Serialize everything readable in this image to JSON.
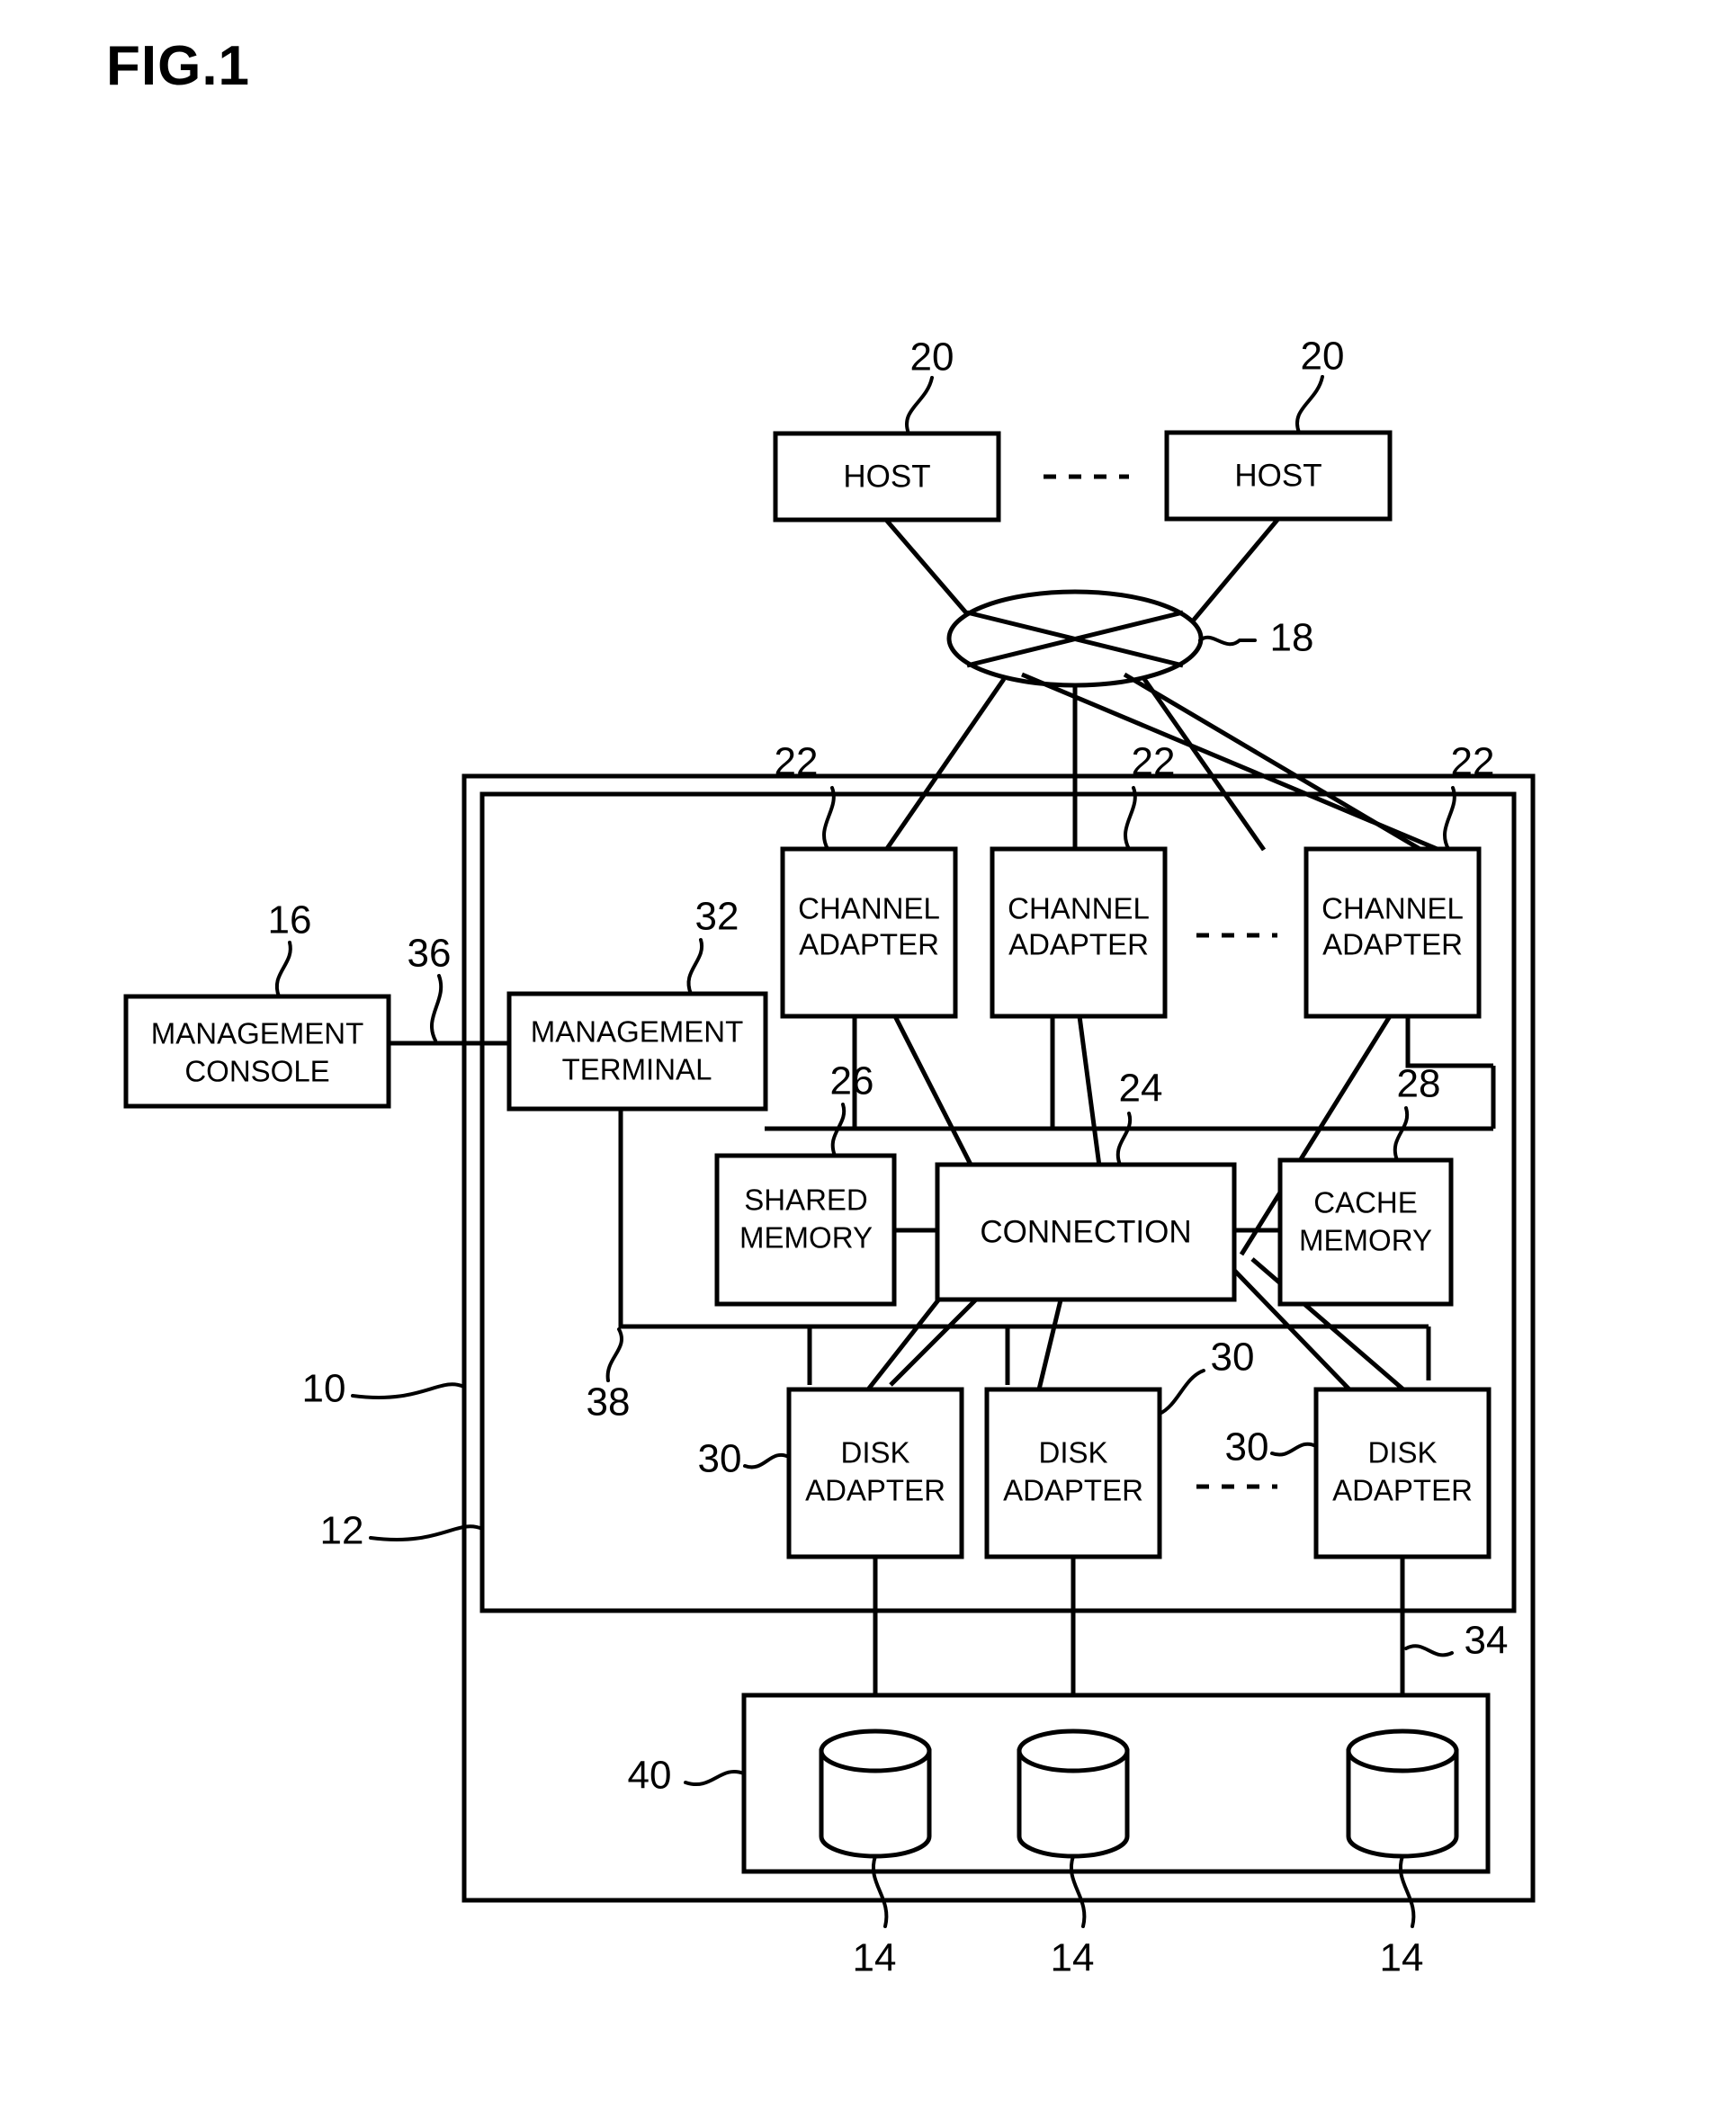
{
  "figure": {
    "title": "FIG.1",
    "type": "patent-block-diagram"
  },
  "nodes": {
    "host_left": {
      "label": "HOST",
      "ref": "20"
    },
    "host_right": {
      "label": "HOST",
      "ref": "20"
    },
    "network": {
      "ref": "18",
      "shape": "ellipse-with-crossing-lines"
    },
    "channel_adapter_1": {
      "line1": "CHANNEL",
      "line2": "ADAPTER",
      "ref": "22"
    },
    "channel_adapter_2": {
      "line1": "CHANNEL",
      "line2": "ADAPTER",
      "ref": "22"
    },
    "channel_adapter_3": {
      "line1": "CHANNEL",
      "line2": "ADAPTER",
      "ref": "22"
    },
    "management_console": {
      "line1": "MANAGEMENT",
      "line2": "CONSOLE",
      "ref": "16"
    },
    "management_terminal": {
      "line1": "MANAGEMENT",
      "line2": "TERMINAL",
      "ref": "32"
    },
    "console_link": {
      "ref": "36"
    },
    "internal_bus": {
      "ref": "38"
    },
    "shared_memory": {
      "line1": "SHARED",
      "line2": "MEMORY",
      "ref": "26"
    },
    "connection": {
      "label": "CONNECTION",
      "ref": "24"
    },
    "cache_memory": {
      "line1": "CACHE",
      "line2": "MEMORY",
      "ref": "28"
    },
    "disk_adapter_1": {
      "line1": "DISK",
      "line2": "ADAPTER",
      "ref": "30"
    },
    "disk_adapter_2": {
      "line1": "DISK",
      "line2": "ADAPTER",
      "ref": "30"
    },
    "disk_adapter_3": {
      "line1": "DISK",
      "line2": "ADAPTER",
      "ref": "30"
    },
    "disk_unit_group": {
      "ref": "40"
    },
    "disk_bus": {
      "ref": "34"
    },
    "storage_system_outer": {
      "ref": "10"
    },
    "storage_controller_inner": {
      "ref": "12"
    },
    "disk_drive_1": {
      "ref": "14"
    },
    "disk_drive_2": {
      "ref": "14"
    },
    "disk_drive_3": {
      "ref": "14"
    }
  },
  "ellipsis_markers": {
    "hosts": "------",
    "channel_adapters": "------",
    "disk_adapters": "------"
  }
}
